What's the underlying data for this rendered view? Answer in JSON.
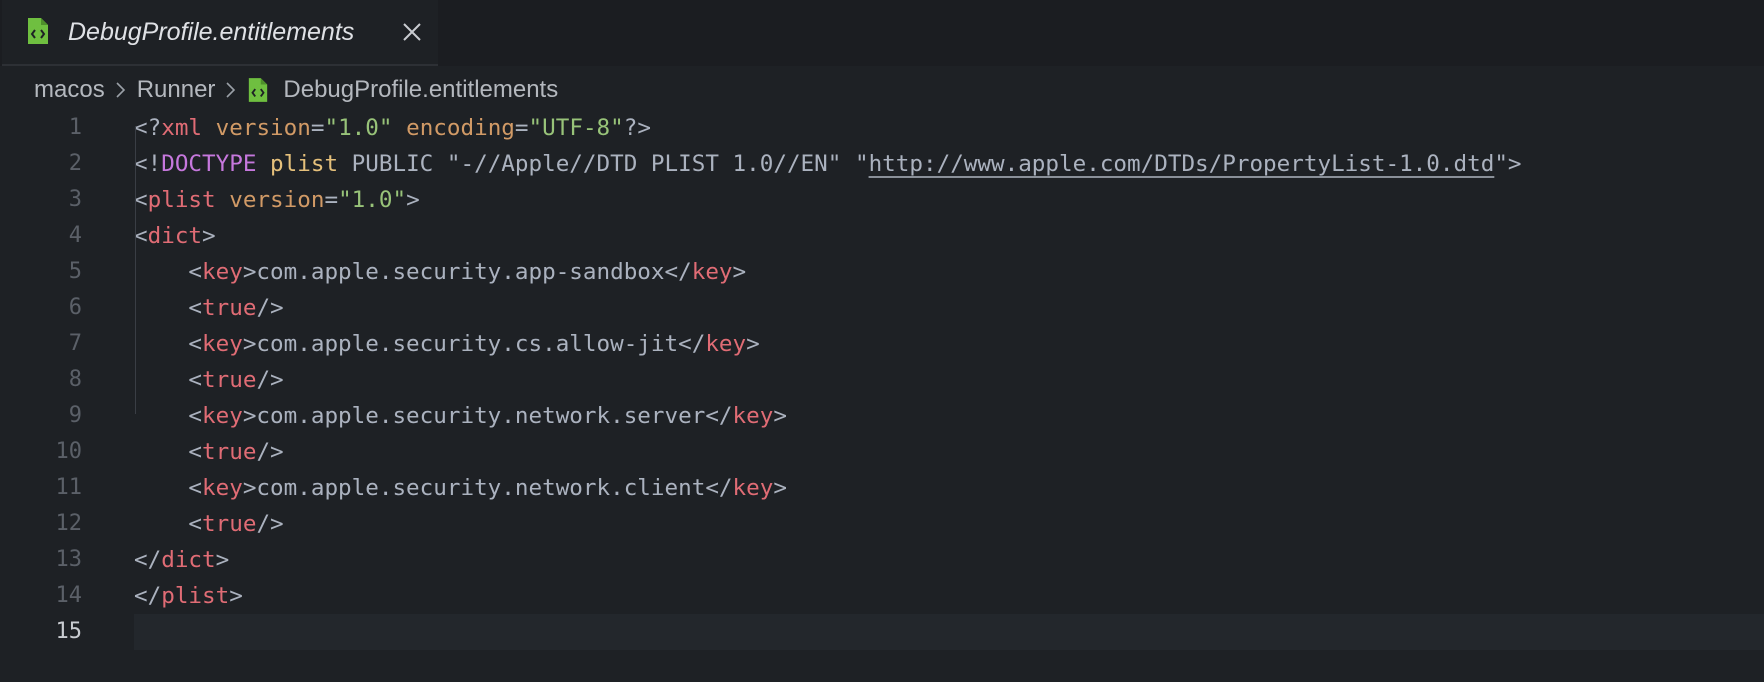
{
  "tab": {
    "label": "DebugProfile.entitlements",
    "icon": "file-code-icon",
    "close_icon": "close-icon",
    "icon_color": "#6fbf40"
  },
  "breadcrumb": {
    "items": [
      "macos",
      "Runner",
      "DebugProfile.entitlements"
    ]
  },
  "editor": {
    "current_line": 15,
    "lines": [
      {
        "n": "1",
        "tokens": [
          [
            "<?",
            "punc"
          ],
          [
            "xml",
            "tag"
          ],
          [
            " ",
            "punc"
          ],
          [
            "version",
            "attr"
          ],
          [
            "=",
            "punc"
          ],
          [
            "\"1.0\"",
            "str"
          ],
          [
            " ",
            "punc"
          ],
          [
            "encoding",
            "attr"
          ],
          [
            "=",
            "punc"
          ],
          [
            "\"UTF-8\"",
            "str"
          ],
          [
            "?>",
            "punc"
          ]
        ]
      },
      {
        "n": "2",
        "tokens": [
          [
            "<!",
            "punc"
          ],
          [
            "DOCTYPE",
            "kw"
          ],
          [
            " ",
            "punc"
          ],
          [
            "plist",
            "name"
          ],
          [
            " PUBLIC \"-//Apple//DTD PLIST 1.0//EN\" \"",
            "punc"
          ],
          [
            "http://www.apple.com/DTDs/PropertyList-1.0.dtd",
            "link"
          ],
          [
            "\">",
            "punc"
          ]
        ]
      },
      {
        "n": "3",
        "tokens": [
          [
            "<",
            "punc"
          ],
          [
            "plist",
            "tag"
          ],
          [
            " ",
            "punc"
          ],
          [
            "version",
            "attr"
          ],
          [
            "=",
            "punc"
          ],
          [
            "\"1.0\"",
            "str"
          ],
          [
            ">",
            "punc"
          ]
        ]
      },
      {
        "n": "4",
        "tokens": [
          [
            "<",
            "punc"
          ],
          [
            "dict",
            "tag"
          ],
          [
            ">",
            "punc"
          ]
        ]
      },
      {
        "n": "5",
        "tokens": [
          [
            "    <",
            "punc"
          ],
          [
            "key",
            "tag"
          ],
          [
            ">com.apple.security.app-sandbox</",
            "punc"
          ],
          [
            "key",
            "tag"
          ],
          [
            ">",
            "punc"
          ]
        ]
      },
      {
        "n": "6",
        "tokens": [
          [
            "    <",
            "punc"
          ],
          [
            "true",
            "tag"
          ],
          [
            "/>",
            "punc"
          ]
        ]
      },
      {
        "n": "7",
        "tokens": [
          [
            "    <",
            "punc"
          ],
          [
            "key",
            "tag"
          ],
          [
            ">com.apple.security.cs.allow-jit</",
            "punc"
          ],
          [
            "key",
            "tag"
          ],
          [
            ">",
            "punc"
          ]
        ]
      },
      {
        "n": "8",
        "tokens": [
          [
            "    <",
            "punc"
          ],
          [
            "true",
            "tag"
          ],
          [
            "/>",
            "punc"
          ]
        ]
      },
      {
        "n": "9",
        "tokens": [
          [
            "    <",
            "punc"
          ],
          [
            "key",
            "tag"
          ],
          [
            ">com.apple.security.network.server</",
            "punc"
          ],
          [
            "key",
            "tag"
          ],
          [
            ">",
            "punc"
          ]
        ]
      },
      {
        "n": "10",
        "tokens": [
          [
            "    <",
            "punc"
          ],
          [
            "true",
            "tag"
          ],
          [
            "/>",
            "punc"
          ]
        ]
      },
      {
        "n": "11",
        "tokens": [
          [
            "    <",
            "punc"
          ],
          [
            "key",
            "tag"
          ],
          [
            ">com.apple.security.network.client</",
            "punc"
          ],
          [
            "key",
            "tag"
          ],
          [
            ">",
            "punc"
          ]
        ]
      },
      {
        "n": "12",
        "tokens": [
          [
            "    <",
            "punc"
          ],
          [
            "true",
            "tag"
          ],
          [
            "/>",
            "punc"
          ]
        ]
      },
      {
        "n": "13",
        "tokens": [
          [
            "</",
            "punc"
          ],
          [
            "dict",
            "tag"
          ],
          [
            ">",
            "punc"
          ]
        ]
      },
      {
        "n": "14",
        "tokens": [
          [
            "</",
            "punc"
          ],
          [
            "plist",
            "tag"
          ],
          [
            ">",
            "punc"
          ]
        ]
      },
      {
        "n": "15",
        "tokens": []
      }
    ]
  }
}
